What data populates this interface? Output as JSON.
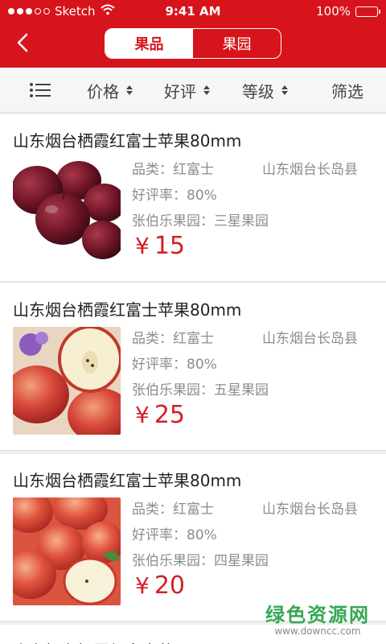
{
  "status_bar": {
    "carrier": "Sketch",
    "time": "9:41 AM",
    "battery": "100%"
  },
  "header": {
    "tabs": [
      {
        "label": "果品",
        "active": true
      },
      {
        "label": "果园",
        "active": false
      }
    ]
  },
  "filters": {
    "price": "价格",
    "rating": "好评",
    "grade": "等级",
    "filter": "筛选"
  },
  "products": [
    {
      "title": "山东烟台栖霞红富士苹果80mm",
      "category": "品类：红富士",
      "location": "山东烟台长岛县",
      "rating": "好评率：80%",
      "orchard": "张伯乐果园：三星果园",
      "currency": "¥",
      "price": "15"
    },
    {
      "title": "山东烟台栖霞红富士苹果80mm",
      "category": "品类：红富士",
      "location": "山东烟台长岛县",
      "rating": "好评率：80%",
      "orchard": "张伯乐果园：五星果园",
      "currency": "¥",
      "price": "25"
    },
    {
      "title": "山东烟台栖霞红富士苹果80mm",
      "category": "品类：红富士",
      "location": "山东烟台长岛县",
      "rating": "好评率：80%",
      "orchard": "张伯乐果园：四星果园",
      "currency": "¥",
      "price": "20"
    }
  ],
  "watermark": {
    "main": "绿色资源网",
    "sub": "www.downcc.com"
  },
  "colors": {
    "brand_red": "#d7141b",
    "price_red": "#d31f26",
    "watermark_green": "#35a853"
  }
}
